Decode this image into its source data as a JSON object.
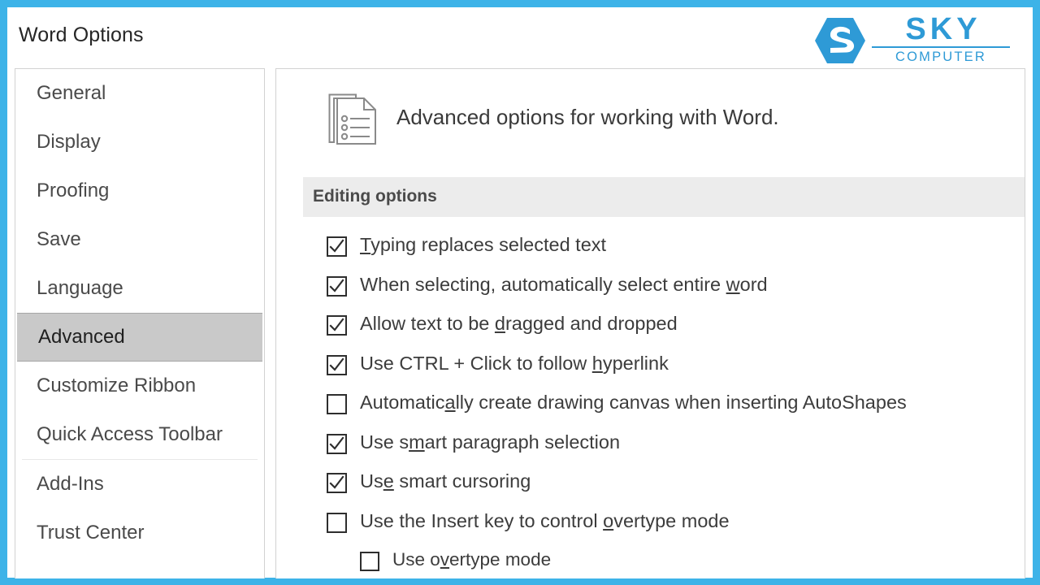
{
  "window": {
    "title": "Word Options"
  },
  "brand": {
    "mark_icon": "hexagon-s-logo-icon",
    "name": "SKY",
    "sub": "COMPUTER",
    "color": "#2e9ad6"
  },
  "theme": {
    "frame_color": "#3db3e8",
    "selected_nav_bg": "#c9c9c9",
    "section_band_bg": "#ececec",
    "text_color": "#3c3c3c"
  },
  "sidebar": {
    "items": [
      {
        "label": "General",
        "selected": false
      },
      {
        "label": "Display",
        "selected": false
      },
      {
        "label": "Proofing",
        "selected": false
      },
      {
        "label": "Save",
        "selected": false
      },
      {
        "label": "Language",
        "selected": false
      },
      {
        "label": "Advanced",
        "selected": true
      },
      {
        "label": "Customize Ribbon",
        "selected": false
      },
      {
        "label": "Quick Access Toolbar",
        "selected": false
      },
      {
        "label": "Add-Ins",
        "selected": false
      },
      {
        "label": "Trust Center",
        "selected": false
      }
    ]
  },
  "main": {
    "header": {
      "icon": "document-list-icon",
      "caption": "Advanced options for working with Word."
    },
    "section": {
      "title": "Editing options"
    },
    "options": [
      {
        "checked": true,
        "indent": false,
        "text": "Typing replaces selected text",
        "parts": [
          {
            "t": "T",
            "u": true
          },
          {
            "t": "yping replaces selected text",
            "u": false
          }
        ]
      },
      {
        "checked": true,
        "indent": false,
        "text": "When selecting, automatically select entire word",
        "parts": [
          {
            "t": "When selecting, automatically select entire ",
            "u": false
          },
          {
            "t": "w",
            "u": true
          },
          {
            "t": "ord",
            "u": false
          }
        ]
      },
      {
        "checked": true,
        "indent": false,
        "text": "Allow text to be dragged and dropped",
        "parts": [
          {
            "t": "Allow text to be ",
            "u": false
          },
          {
            "t": "d",
            "u": true
          },
          {
            "t": "ragged and dropped",
            "u": false
          }
        ]
      },
      {
        "checked": true,
        "indent": false,
        "text": "Use CTRL + Click to follow hyperlink",
        "parts": [
          {
            "t": "Use CTRL + Click to follow ",
            "u": false
          },
          {
            "t": "h",
            "u": true
          },
          {
            "t": "yperlink",
            "u": false
          }
        ]
      },
      {
        "checked": false,
        "indent": false,
        "text": "Automatically create drawing canvas when inserting AutoShapes",
        "parts": [
          {
            "t": "Automatic",
            "u": false
          },
          {
            "t": "a",
            "u": true
          },
          {
            "t": "lly create drawing canvas when inserting AutoShapes",
            "u": false
          }
        ]
      },
      {
        "checked": true,
        "indent": false,
        "text": "Use smart paragraph selection",
        "parts": [
          {
            "t": "Use s",
            "u": false
          },
          {
            "t": "m",
            "u": true
          },
          {
            "t": "art paragraph selection",
            "u": false
          }
        ]
      },
      {
        "checked": true,
        "indent": false,
        "text": "Use smart cursoring",
        "parts": [
          {
            "t": "Us",
            "u": false
          },
          {
            "t": "e",
            "u": true
          },
          {
            "t": " smart cursoring",
            "u": false
          }
        ]
      },
      {
        "checked": false,
        "indent": false,
        "text": "Use the Insert key to control overtype mode",
        "parts": [
          {
            "t": "Use the Insert key to control ",
            "u": false
          },
          {
            "t": "o",
            "u": true
          },
          {
            "t": "vertype mode",
            "u": false
          }
        ]
      },
      {
        "checked": false,
        "indent": true,
        "text": "Use overtype mode",
        "parts": [
          {
            "t": "Use o",
            "u": false
          },
          {
            "t": "v",
            "u": true
          },
          {
            "t": "ertype mode",
            "u": false
          }
        ]
      }
    ]
  }
}
